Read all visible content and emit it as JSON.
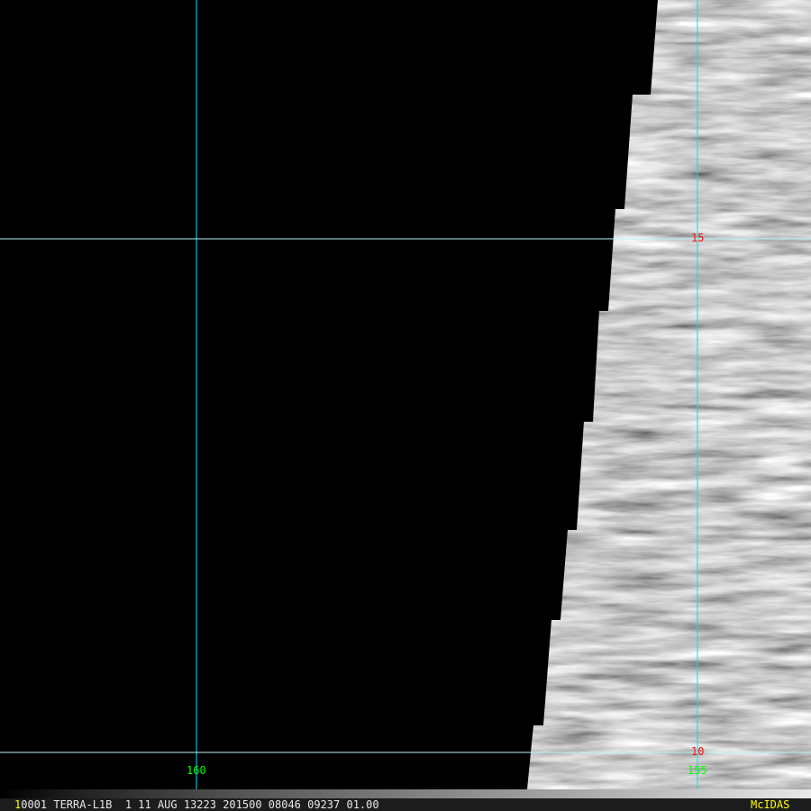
{
  "image": {
    "satellite_data": "TERRA-L1B",
    "grid_color": "#00e5ee",
    "lon_labels": [
      "160",
      "155"
    ],
    "lat_labels": [
      "15",
      "10"
    ]
  },
  "status_bar": {
    "frame_number": "1",
    "text": "0001 TERRA-L1B  1 11 AUG 13223 201500 08046 09237 01.00",
    "brand": "McIDAS"
  }
}
